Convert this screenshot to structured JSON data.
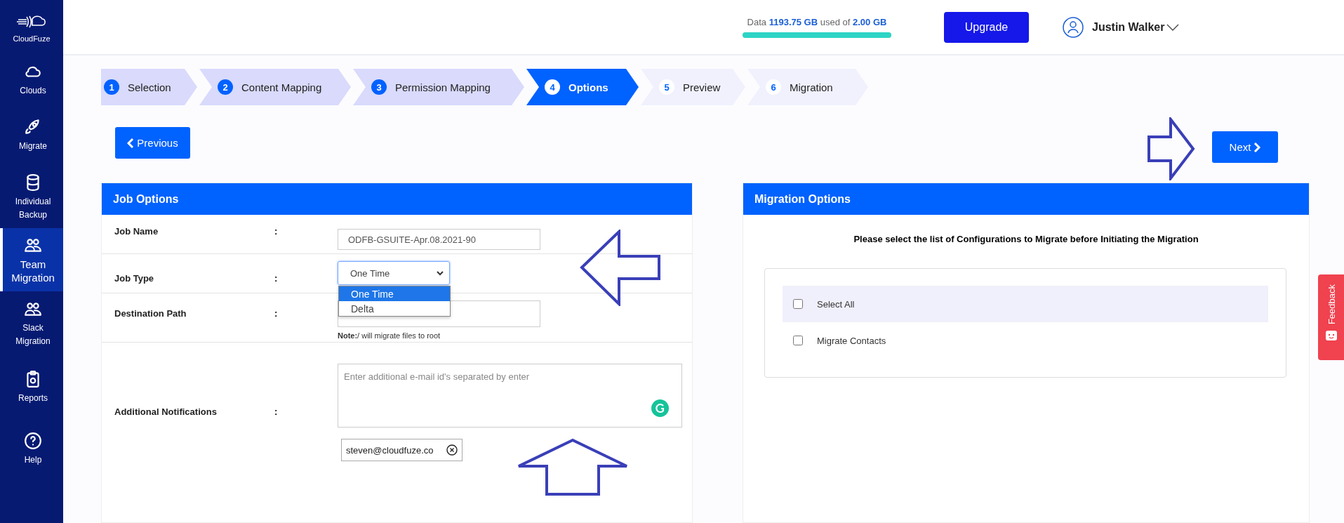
{
  "sidebar": {
    "logo": "CloudFuze",
    "items": [
      {
        "label": "Clouds",
        "kind": "cloud",
        "selected": false
      },
      {
        "label": "Migrate",
        "kind": "rocket",
        "selected": false
      },
      {
        "label": "Individual Backup",
        "kind": "database",
        "selected": false
      },
      {
        "label": "Team Migration",
        "kind": "users",
        "selected": true
      },
      {
        "label": "Slack Migration",
        "kind": "users",
        "selected": false
      },
      {
        "label": "Reports",
        "kind": "clipboard",
        "selected": false
      },
      {
        "label": "Help",
        "kind": "help",
        "selected": false
      }
    ]
  },
  "header": {
    "usage": {
      "prefix": "Data",
      "used": "1193.75 GB",
      "middle": "used of",
      "total": "2.00 GB",
      "level": 1
    },
    "upgrade": "Upgrade",
    "user": "Justin Walker"
  },
  "steps": [
    {
      "number": "1",
      "label": "Selection",
      "kind": "done",
      "selected": false
    },
    {
      "number": "2",
      "label": "Content Mapping",
      "kind": "done",
      "selected": false
    },
    {
      "number": "3",
      "label": "Permission Mapping",
      "kind": "done",
      "selected": false
    },
    {
      "number": "4",
      "label": "Options",
      "kind": "current",
      "selected": true
    },
    {
      "number": "5",
      "label": "Preview",
      "kind": "upcoming",
      "selected": false
    },
    {
      "number": "6",
      "label": "Migration",
      "kind": "upcoming",
      "selected": false
    }
  ],
  "previous": "Previous",
  "next": "Next",
  "job_options": {
    "title": "Job Options",
    "job_name": {
      "label": "Job Name",
      "colon": ":",
      "value": "ODFB-GSUITE-Apr.08.2021-90"
    },
    "job_type": {
      "label": "Job Type",
      "colon": ":",
      "value": "One Time",
      "expanded": true,
      "options": [
        {
          "label": "One Time",
          "selected": true
        },
        {
          "label": "Delta",
          "selected": false
        }
      ]
    },
    "destination": {
      "label": "Destination Path",
      "colon": ":",
      "note": "**Note:**/ will migrate files to root"
    },
    "notifications": {
      "label": "Additional Notifications",
      "colon": ":",
      "placeholder": "Enter additional e-mail id's separated by enter",
      "emails": [
        "steven@cloudfuze.co"
      ]
    }
  },
  "migration_options": {
    "title": "Migration Options",
    "heading": "Please select the list of Configurations to Migrate before Initiating the Migration",
    "items": [
      {
        "label": "Select All",
        "checked": false,
        "highlighted": true
      },
      {
        "label": "Migrate Contacts",
        "checked": false,
        "highlighted": false
      }
    ]
  },
  "feedback": "Feedback"
}
